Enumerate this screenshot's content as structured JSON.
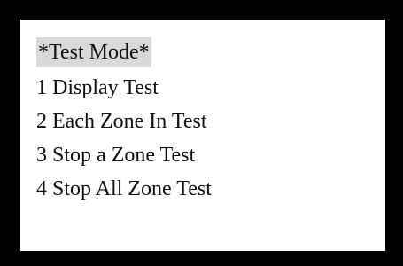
{
  "screen": {
    "title": "*Test Mode*",
    "title_highlight_color": "#d9d9d9",
    "items": [
      {
        "label": "1 Display Test"
      },
      {
        "label": "2 Each Zone In Test"
      },
      {
        "label": "3 Stop a Zone Test"
      },
      {
        "label": "4 Stop All Zone Test"
      }
    ]
  }
}
